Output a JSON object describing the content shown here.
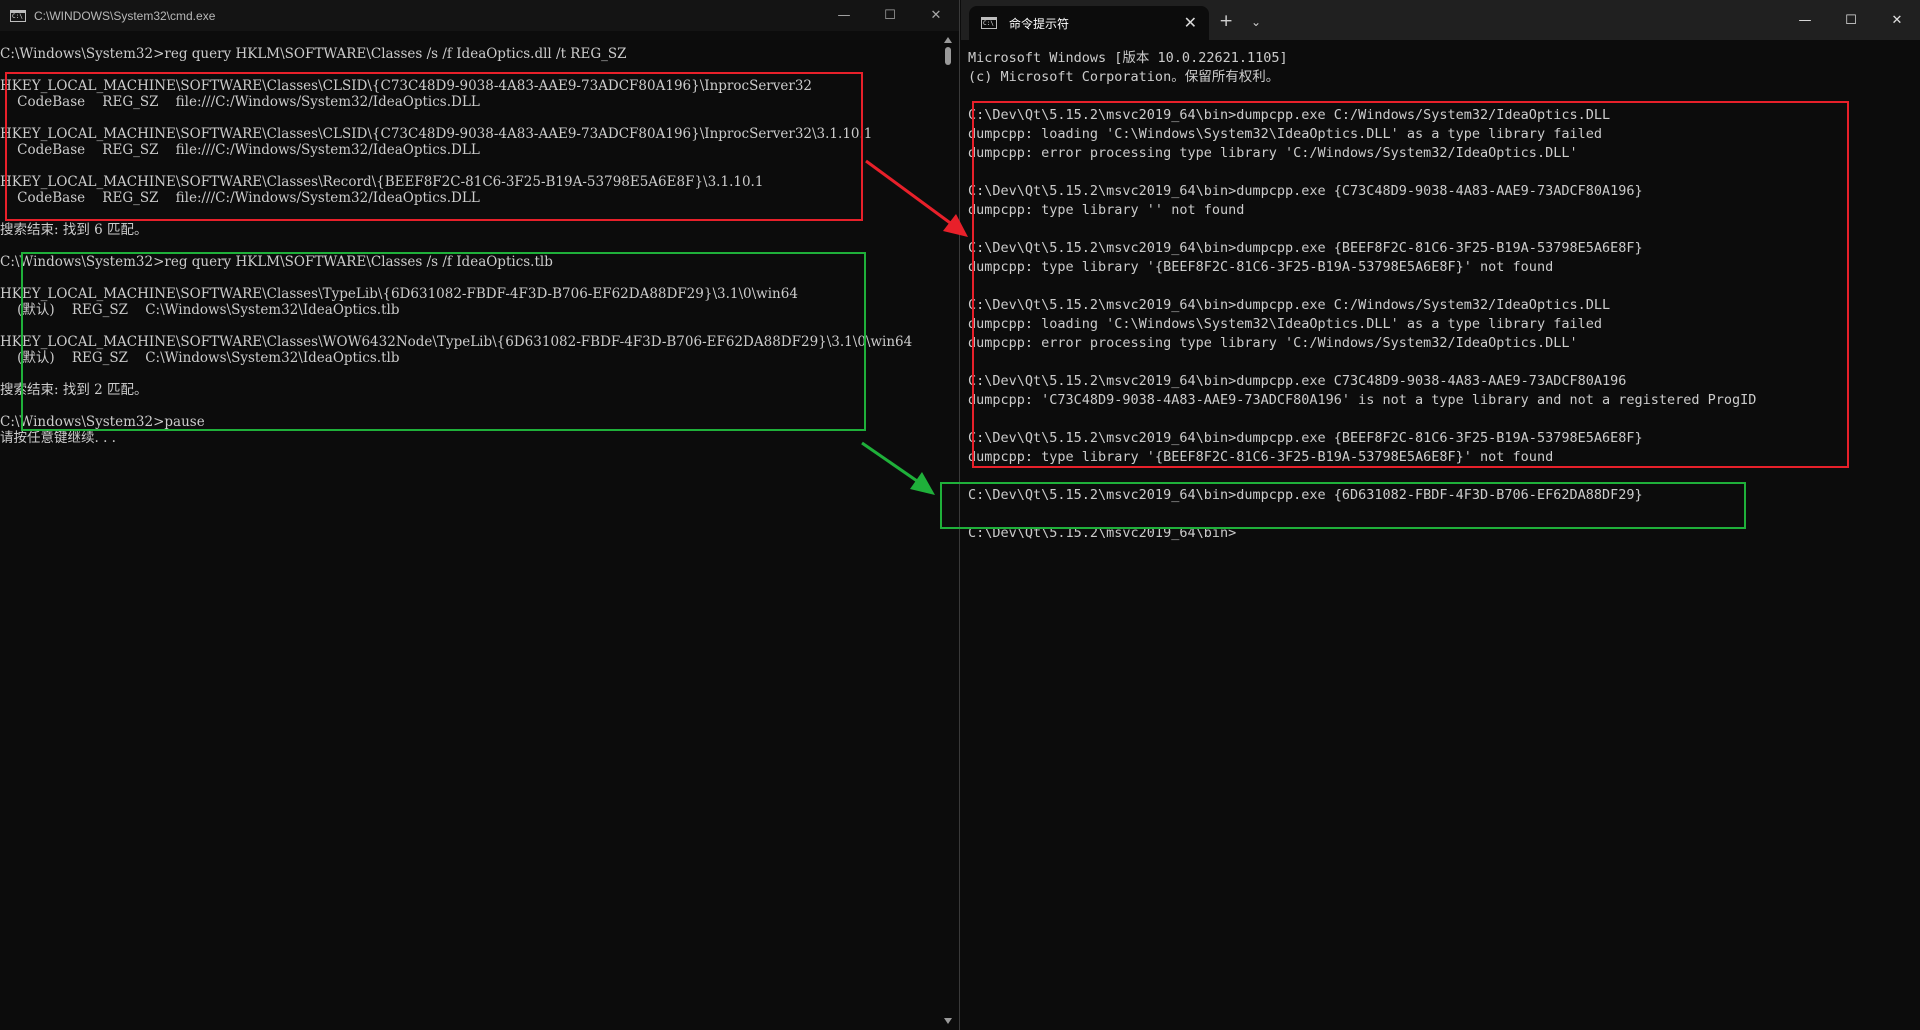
{
  "left_window": {
    "title": "C:\\WINDOWS\\System32\\cmd.exe",
    "controls": {
      "minimize": "—",
      "maximize": "☐",
      "close": "✕"
    },
    "lines": [
      "C:\\Windows\\System32>reg query HKLM\\SOFTWARE\\Classes /s /f IdeaOptics.dll /t REG_SZ",
      "",
      "HKEY_LOCAL_MACHINE\\SOFTWARE\\Classes\\CLSID\\{C73C48D9-9038-4A83-AAE9-73ADCF80A196}\\InprocServer32",
      "    CodeBase    REG_SZ    file:///C:/Windows/System32/IdeaOptics.DLL",
      "",
      "HKEY_LOCAL_MACHINE\\SOFTWARE\\Classes\\CLSID\\{C73C48D9-9038-4A83-AAE9-73ADCF80A196}\\InprocServer32\\3.1.10.1",
      "    CodeBase    REG_SZ    file:///C:/Windows/System32/IdeaOptics.DLL",
      "",
      "HKEY_LOCAL_MACHINE\\SOFTWARE\\Classes\\Record\\{BEEF8F2C-81C6-3F25-B19A-53798E5A6E8F}\\3.1.10.1",
      "    CodeBase    REG_SZ    file:///C:/Windows/System32/IdeaOptics.DLL",
      "",
      "搜索结束: 找到 6 匹配。",
      "",
      "C:\\Windows\\System32>reg query HKLM\\SOFTWARE\\Classes /s /f IdeaOptics.tlb",
      "",
      "HKEY_LOCAL_MACHINE\\SOFTWARE\\Classes\\TypeLib\\{6D631082-FBDF-4F3D-B706-EF62DA88DF29}\\3.1\\0\\win64",
      "    (默认)    REG_SZ    C:\\Windows\\System32\\IdeaOptics.tlb",
      "",
      "HKEY_LOCAL_MACHINE\\SOFTWARE\\Classes\\WOW6432Node\\TypeLib\\{6D631082-FBDF-4F3D-B706-EF62DA88DF29}\\3.1\\0\\win64",
      "    (默认)    REG_SZ    C:\\Windows\\System32\\IdeaOptics.tlb",
      "",
      "搜索结束: 找到 2 匹配。",
      "",
      "C:\\Windows\\System32>pause",
      "请按任意键继续. . ."
    ]
  },
  "right_window": {
    "tab_title": "命令提示符",
    "tab_close": "✕",
    "new_tab": "+",
    "dropdown": "⌄",
    "controls": {
      "minimize": "—",
      "maximize": "☐",
      "close": "✕"
    },
    "lines": [
      "Microsoft Windows [版本 10.0.22621.1105]",
      "(c) Microsoft Corporation。保留所有权利。",
      "",
      "C:\\Dev\\Qt\\5.15.2\\msvc2019_64\\bin>dumpcpp.exe C:/Windows/System32/IdeaOptics.DLL",
      "dumpcpp: loading 'C:\\Windows\\System32\\IdeaOptics.DLL' as a type library failed",
      "dumpcpp: error processing type library 'C:/Windows/System32/IdeaOptics.DLL'",
      "",
      "C:\\Dev\\Qt\\5.15.2\\msvc2019_64\\bin>dumpcpp.exe {C73C48D9-9038-4A83-AAE9-73ADCF80A196}",
      "dumpcpp: type library '' not found",
      "",
      "C:\\Dev\\Qt\\5.15.2\\msvc2019_64\\bin>dumpcpp.exe {BEEF8F2C-81C6-3F25-B19A-53798E5A6E8F}",
      "dumpcpp: type library '{BEEF8F2C-81C6-3F25-B19A-53798E5A6E8F}' not found",
      "",
      "C:\\Dev\\Qt\\5.15.2\\msvc2019_64\\bin>dumpcpp.exe C:/Windows/System32/IdeaOptics.DLL",
      "dumpcpp: loading 'C:\\Windows\\System32\\IdeaOptics.DLL' as a type library failed",
      "dumpcpp: error processing type library 'C:/Windows/System32/IdeaOptics.DLL'",
      "",
      "C:\\Dev\\Qt\\5.15.2\\msvc2019_64\\bin>dumpcpp.exe C73C48D9-9038-4A83-AAE9-73ADCF80A196",
      "dumpcpp: 'C73C48D9-9038-4A83-AAE9-73ADCF80A196' is not a type library and not a registered ProgID",
      "",
      "C:\\Dev\\Qt\\5.15.2\\msvc2019_64\\bin>dumpcpp.exe {BEEF8F2C-81C6-3F25-B19A-53798E5A6E8F}",
      "dumpcpp: type library '{BEEF8F2C-81C6-3F25-B19A-53798E5A6E8F}' not found",
      "",
      "C:\\Dev\\Qt\\5.15.2\\msvc2019_64\\bin>dumpcpp.exe {6D631082-FBDF-4F3D-B706-EF62DA88DF29}",
      "",
      "C:\\Dev\\Qt\\5.15.2\\msvc2019_64\\bin>"
    ]
  },
  "annotations": {
    "highlight_color_red": "#e8202a",
    "highlight_color_green": "#1fb03a"
  }
}
